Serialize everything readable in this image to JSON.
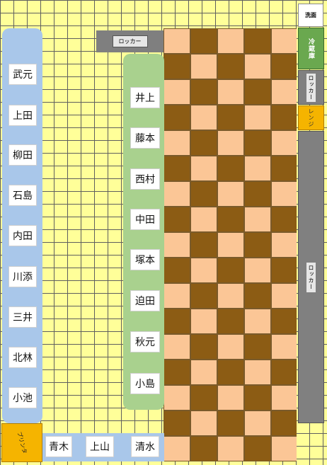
{
  "labels": {
    "sink": "洗面",
    "fridge": "冷蔵庫",
    "locker_top": "ロッカー",
    "locker_right_small": "ロッカー",
    "range": "レンジ",
    "locker_right_tall": "ロッカー",
    "printer": "プリンタ"
  },
  "left_desks": [
    "武元",
    "上田",
    "柳田",
    "石島",
    "内田",
    "川添",
    "三井",
    "北林",
    "小池"
  ],
  "center_desks": [
    "井上",
    "藤本",
    "西村",
    "中田",
    "塚本",
    "迫田",
    "秋元",
    "小島"
  ],
  "bottom_desks": [
    "青木",
    "上山",
    "清水"
  ],
  "colors": {
    "floor": "#ffff99",
    "left_column": "#a9c7ea",
    "center_column": "#a9d18e",
    "checker_light": "#fbc696",
    "checker_dark": "#8c5c14",
    "sink": "#ffffff",
    "fridge": "#6aa84f",
    "locker": "#808080",
    "range": "#f5b400",
    "printer": "#f5b400"
  }
}
